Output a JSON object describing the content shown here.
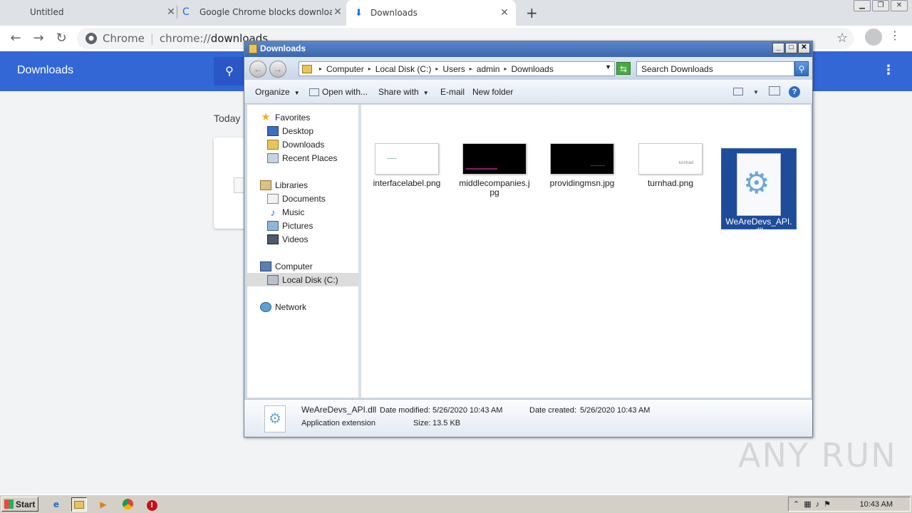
{
  "chrome": {
    "tabs": [
      {
        "title": "Untitled",
        "active": false
      },
      {
        "title": "Google Chrome blocks downloads - G",
        "active": false
      },
      {
        "title": "Downloads",
        "active": true
      }
    ],
    "new_tab": "+",
    "omnibox": {
      "scheme_label": "Chrome",
      "url_prefix": "chrome://",
      "url_host": "downloads"
    }
  },
  "downloads_page": {
    "title": "Downloads",
    "section_date": "Today"
  },
  "explorer": {
    "title": "Downloads",
    "breadcrumb": [
      "Computer",
      "Local Disk (C:)",
      "Users",
      "admin",
      "Downloads"
    ],
    "search_placeholder": "Search Downloads",
    "commands": {
      "organize": "Organize",
      "open_with": "Open with...",
      "share_with": "Share with",
      "email": "E-mail",
      "new_folder": "New folder"
    },
    "nav": {
      "favorites": "Favorites",
      "desktop": "Desktop",
      "downloads": "Downloads",
      "recent_places": "Recent Places",
      "libraries": "Libraries",
      "documents": "Documents",
      "music": "Music",
      "pictures": "Pictures",
      "videos": "Videos",
      "computer": "Computer",
      "local_disk": "Local Disk (C:)",
      "network": "Network"
    },
    "files": [
      {
        "name": "interfacelabel.png",
        "thumb": "white"
      },
      {
        "name": "middlecompanies.jpg",
        "thumb": "black"
      },
      {
        "name": "providingmsn.jpg",
        "thumb": "black"
      },
      {
        "name": "turnhad.png",
        "thumb": "white",
        "thumb_text": "turnhad"
      },
      {
        "name": "WeAreDevs_API.dll",
        "selected": true
      }
    ],
    "details": {
      "name": "WeAreDevs_API.dll",
      "type": "Application extension",
      "modified_label": "Date modified:",
      "modified": "5/26/2020 10:43 AM",
      "created_label": "Date created:",
      "created": "5/26/2020 10:43 AM",
      "size_label": "Size:",
      "size": "13.5 KB"
    }
  },
  "watermark": "ANY RUN",
  "taskbar": {
    "start": "Start",
    "clock": "10:43 AM"
  },
  "colors": {
    "chrome_blue": "#3367d6",
    "selection_blue": "#1e4c9a",
    "taskbar_gray": "#d4d0c8"
  }
}
